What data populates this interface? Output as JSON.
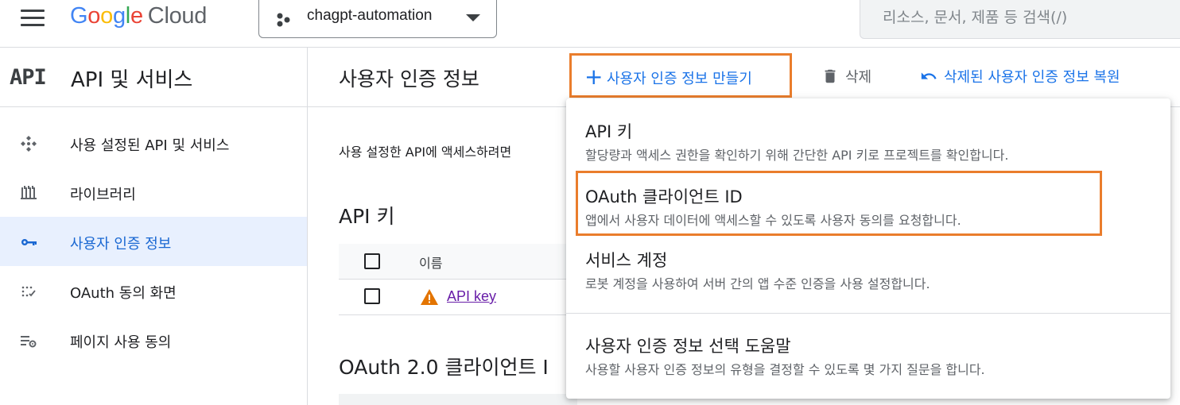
{
  "header": {
    "logo_google": "Google",
    "logo_cloud": "Cloud",
    "project": "chagpt-automation",
    "search_placeholder": "리소스, 문서, 제품 등 검색(/)"
  },
  "sidebar": {
    "logo": "API",
    "title": "API 및 서비스",
    "items": [
      {
        "label": "사용 설정된 API 및 서비스",
        "icon": "enabled-apis-icon"
      },
      {
        "label": "라이브러리",
        "icon": "library-icon"
      },
      {
        "label": "사용자 인증 정보",
        "icon": "key-icon",
        "active": true
      },
      {
        "label": "OAuth 동의 화면",
        "icon": "oauth-consent-icon"
      },
      {
        "label": "페이지 사용 동의",
        "icon": "page-usage-icon"
      }
    ]
  },
  "main": {
    "title": "사용자 인증 정보",
    "create_button": "사용자 인증 정보 만들기",
    "delete_button": "삭제",
    "restore_button": "삭제된 사용자 인증 정보 복원",
    "description": "사용 설정한 API에 액세스하려면",
    "api_keys_title": "API 키",
    "column_name": "이름",
    "api_key_name": "API key",
    "oauth_title": "OAuth 2.0 클라이언트 I"
  },
  "dropdown": {
    "items": [
      {
        "title": "API 키",
        "desc": "할당량과 액세스 권한을 확인하기 위해 간단한 API 키로 프로젝트를 확인합니다."
      },
      {
        "title": "OAuth 클라이언트 ID",
        "desc": "앱에서 사용자 데이터에 액세스할 수 있도록 사용자 동의를 요청합니다."
      },
      {
        "title": "서비스 계정",
        "desc": "로봇 계정을 사용하여 서버 간의 앱 수준 인증을 사용 설정합니다."
      },
      {
        "title": "사용자 인증 정보 선택 도움말",
        "desc": "사용할 사용자 인증 정보의 유형을 결정할 수 있도록 몇 가지 질문을 합니다."
      }
    ]
  },
  "colors": {
    "accent": "#1a73e8",
    "highlight": "#ea7d2c",
    "active_bg": "#e8f0fe",
    "warning": "#e37400"
  }
}
